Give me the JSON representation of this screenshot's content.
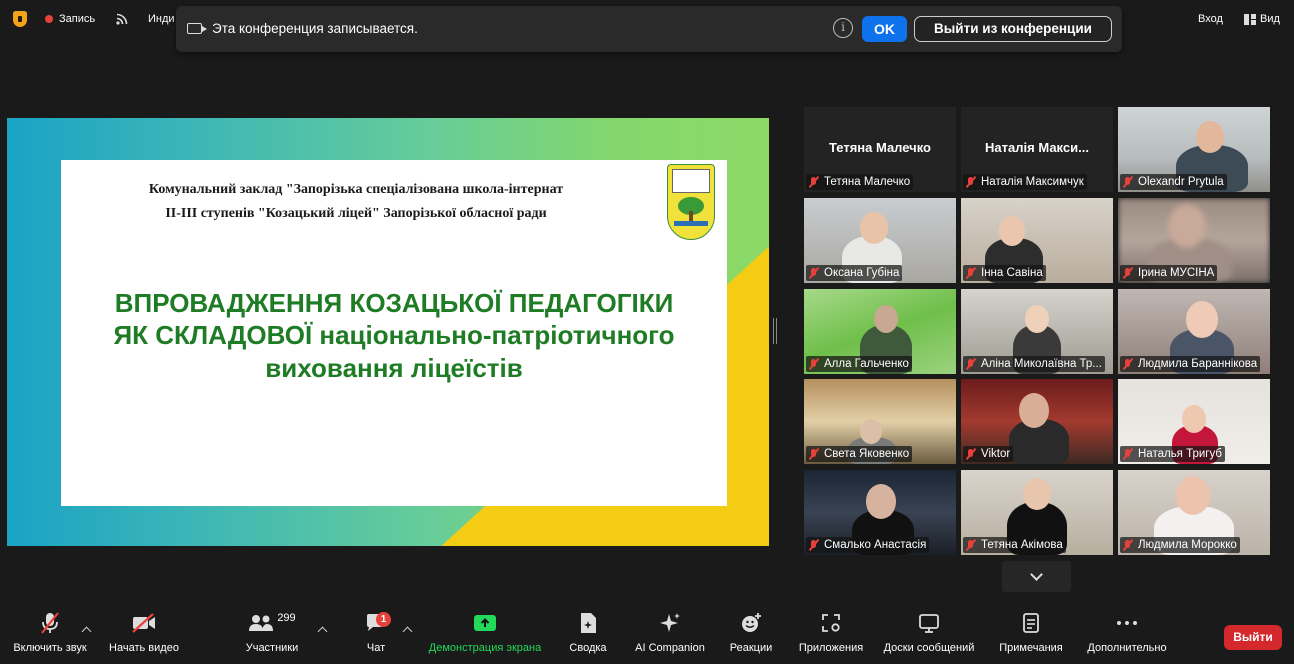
{
  "topbar": {
    "record_label": "Запись",
    "indicator_label": "Инди",
    "signin_label": "Вход",
    "view_label": "Вид"
  },
  "banner": {
    "message": "Эта конференция записывается.",
    "ok_label": "OK",
    "leave_label": "Выйти из конференции"
  },
  "slide": {
    "institution_line1": "Комунальний заклад \"Запорізька спеціалізована школа-інтернат",
    "institution_line2": "ІІ-ІІІ ступенів \"Козацький ліцей\" Запорізької обласної ради",
    "title_line1": "ВПРОВАДЖЕННЯ КОЗАЦЬКОЇ ПЕДАГОГІКИ",
    "title_line2": "ЯК СКЛАДОВОЇ національно-патріотичного",
    "title_line3": "виховання ліцеїстів",
    "colors": {
      "title": "#1e7c24",
      "left_gradient": "#1aa3c5",
      "right_gradient": "#8cd966",
      "accent": "#f4cc13"
    }
  },
  "participants": [
    {
      "name": "Тетяна Малечко",
      "video": false,
      "display": "Тетяна Малечко"
    },
    {
      "name": "Наталія Максимчук",
      "video": false,
      "display": "Наталія  Макси..."
    },
    {
      "name": "Olexandr Prytula",
      "video": true
    },
    {
      "name": "Оксана Губіна",
      "video": true,
      "active": true
    },
    {
      "name": "Інна Савіна",
      "video": true
    },
    {
      "name": "Ірина МУСІНА",
      "video": true
    },
    {
      "name": "Алла Гальченко",
      "video": true
    },
    {
      "name": "Аліна Миколаївна Тр...",
      "video": true
    },
    {
      "name": "Людмила Бараннікова",
      "video": true
    },
    {
      "name": "Света Яковенко",
      "video": true
    },
    {
      "name": "Viktor",
      "video": true
    },
    {
      "name": "Наталья Тригуб",
      "video": true
    },
    {
      "name": "Смалько Анастасія",
      "video": true
    },
    {
      "name": "Тетяна Акімова",
      "video": true
    },
    {
      "name": "Людмила Морокко",
      "video": true
    }
  ],
  "toolbar": {
    "unmute_label": "Включить звук",
    "start_video_label": "Начать видео",
    "participants_label": "Участники",
    "participants_count": "299",
    "chat_label": "Чат",
    "chat_badge": "1",
    "share_label": "Демонстрация экрана",
    "summary_label": "Сводка",
    "ai_label": "AI Companion",
    "reactions_label": "Реакции",
    "apps_label": "Приложения",
    "whiteboards_label": "Доски сообщений",
    "notes_label": "Примечания",
    "more_label": "Дополнительно",
    "end_label": "Выйти"
  },
  "icons": {
    "security": "shield-icon",
    "record": "record-dot-icon",
    "live": "broadcast-icon",
    "mic": "mic-off-icon",
    "video": "video-off-icon",
    "participants": "people-icon",
    "chat": "chat-bubble-icon",
    "share": "share-screen-icon",
    "summary": "summary-doc-icon",
    "ai": "sparkle-icon",
    "reactions": "smiley-plus-icon",
    "apps": "apps-icon",
    "whiteboard": "whiteboard-icon",
    "notes": "notes-icon",
    "more": "ellipsis-icon"
  }
}
